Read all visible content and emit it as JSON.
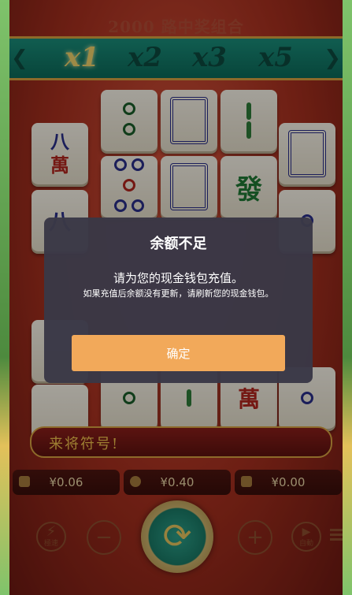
{
  "banner": {
    "title": "2000 路中奖组合"
  },
  "multipliers": [
    {
      "label": "x1",
      "active": true
    },
    {
      "label": "x2",
      "active": false
    },
    {
      "label": "x3",
      "active": false
    },
    {
      "label": "x5",
      "active": false
    }
  ],
  "tiles": {
    "wan_char": "萬",
    "eight_char": "八",
    "fa_char": "發"
  },
  "ticker": {
    "text": "来将符号!"
  },
  "stats": {
    "balance": "¥0.06",
    "bet": "¥0.40",
    "win": "¥0.00"
  },
  "controls": {
    "turbo_label": "極速",
    "auto_label": "自動",
    "minus": "−",
    "plus": "+"
  },
  "dialog": {
    "title": "余额不足",
    "message": "请为您的现金钱包充值。",
    "sub": "如果充值后余额没有更新，请刷新您的现金钱包。",
    "confirm": "确定"
  },
  "colors": {
    "accent": "#f2a95a",
    "dialog_bg": "#3a3846",
    "multiplier_bar": "#0c6b5a"
  }
}
